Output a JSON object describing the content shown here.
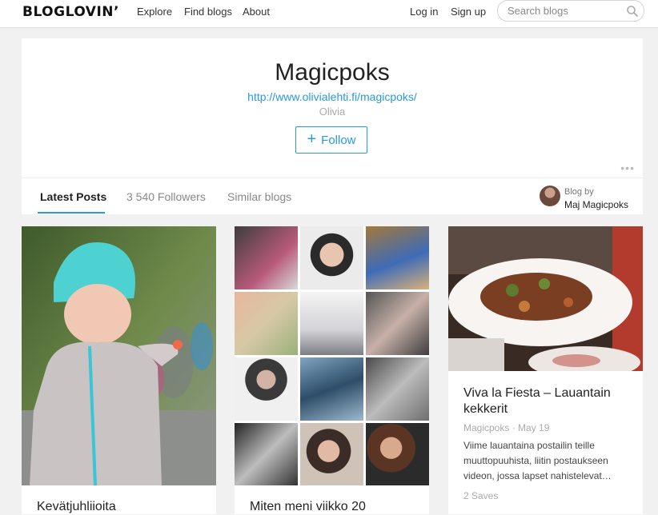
{
  "nav": {
    "logo": "BLOGLOVIN’",
    "explore": "Explore",
    "find_blogs": "Find blogs",
    "about": "About",
    "login": "Log in",
    "signup": "Sign up",
    "search_placeholder": "Search blogs",
    "search_icon": "search-icon"
  },
  "profile": {
    "title": "Magicpoks",
    "url": "http://www.olivialehti.fi/magicpoks/",
    "author": "Olivia",
    "follow_label": "Follow",
    "more_icon": "more-dots-icon"
  },
  "tabs": {
    "latest": "Latest Posts",
    "followers": "3 540 Followers",
    "similar": "Similar blogs"
  },
  "blog_by": {
    "label": "Blog by",
    "name": "Maj Magicpoks"
  },
  "posts": [
    {
      "title": "Kevätjuhliioita"
    },
    {
      "title": "Miten meni viikko 20"
    },
    {
      "title": "Viva la Fiesta – Lauantain kekkerit",
      "meta": "Magicpoks · May 19",
      "excerpt": "Viime lauantaina postailin teille muuttopuuhista, liitin postaukseen videon, jossa lapset nahistelevat…",
      "saves": "2 Saves"
    }
  ],
  "colors": {
    "accent": "#2a9ad8",
    "background": "#f1f1f1"
  }
}
